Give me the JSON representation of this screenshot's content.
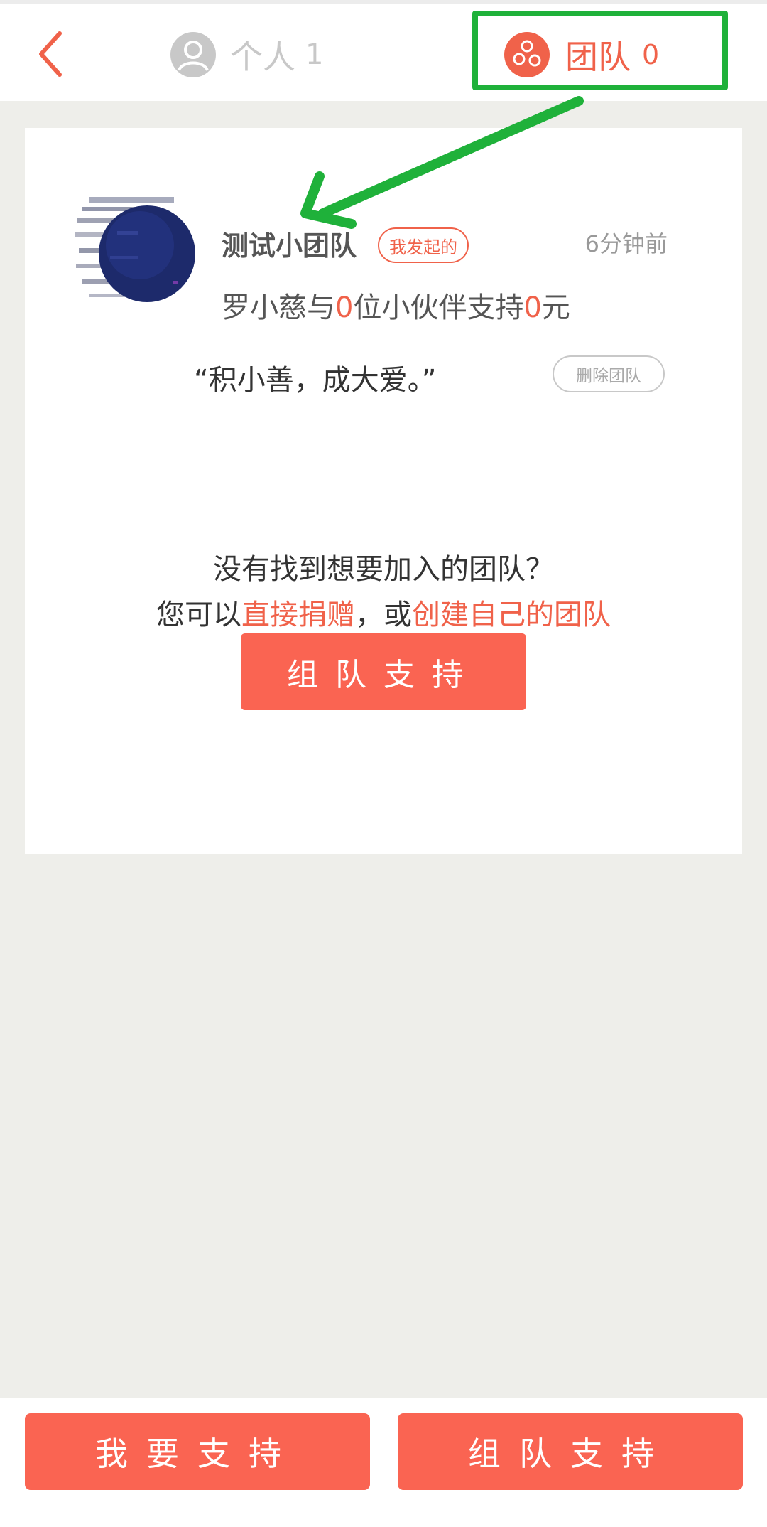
{
  "header": {
    "back_icon": "chevron-left-icon",
    "tab_personal": {
      "label": "个人",
      "count": "1",
      "icon": "user-avatar-icon"
    },
    "tab_team": {
      "label": "团队",
      "count": "0",
      "icon": "team-icon"
    }
  },
  "team": {
    "name": "测试小团队",
    "badge": "我发起的",
    "time_ago": "6分钟前",
    "support_prefix": "罗小慈与",
    "partner_count": "0",
    "support_middle": "位小伙伴支持",
    "amount": "0",
    "support_suffix": "元",
    "motto": "“积小善，成大爱。”",
    "delete_label": "删除团队"
  },
  "prompt": {
    "line1": "没有找到想要加入的团队？",
    "line2_prefix": "您可以",
    "donate_link": "直接捐赠",
    "line2_middle": "，或",
    "create_link": "创建自己的团队",
    "team_button": "组队支持"
  },
  "footer": {
    "support_button": "我要支持",
    "team_button": "组队支持"
  },
  "colors": {
    "accent": "#f0624a",
    "button": "#fa6452",
    "highlight": "#1fb13a",
    "background": "#eeeeea"
  }
}
